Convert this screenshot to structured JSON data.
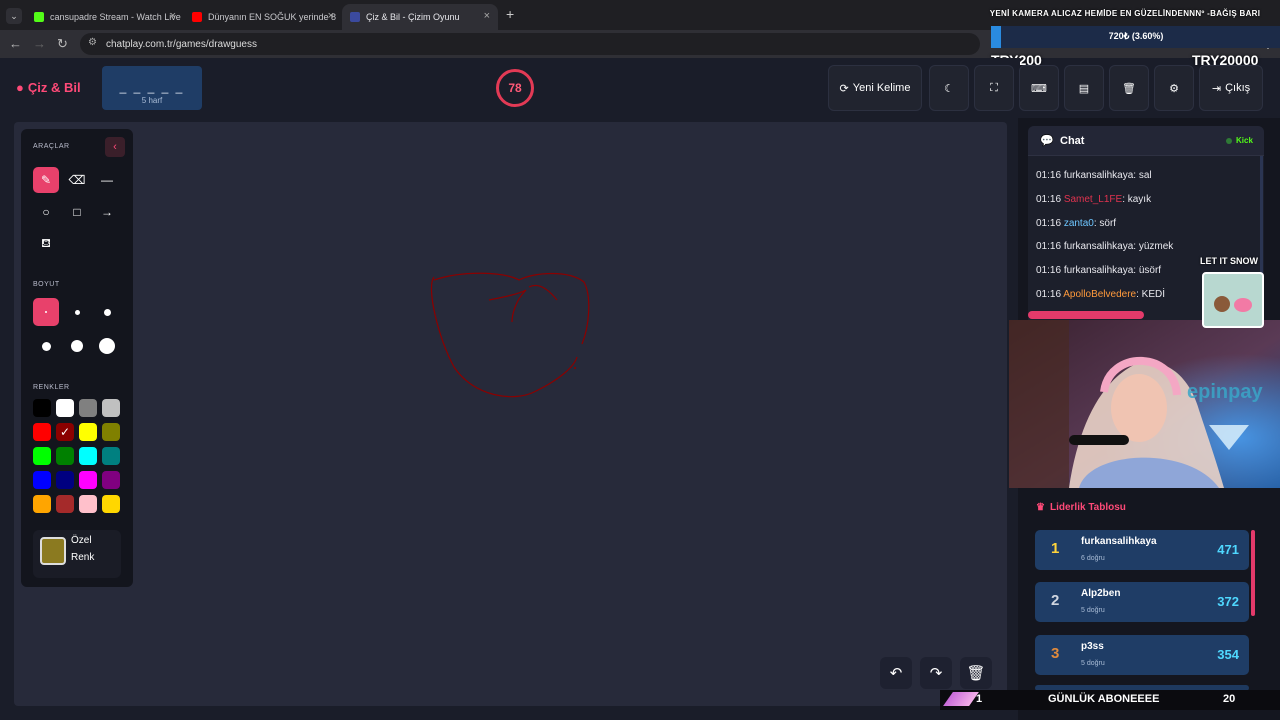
{
  "browser": {
    "tabs": [
      {
        "title": "cansupadre Stream - Watch Live"
      },
      {
        "title": "Dünyanın EN SOĞUK yerinde 8"
      },
      {
        "title": "Çiz & Bil - Çizim Oyunu"
      }
    ],
    "new_tab": "+",
    "url": "chatplay.com.tr/games/drawguess"
  },
  "overlay": {
    "title": "YENİ KAMERA ALICAZ HEMİDE EN GÜZELİNDENNNº -BAĞIŞ BARI",
    "goal_text": "720₺ (3.60%)",
    "goal_fraction": 0.036,
    "goal_left": "TRY200",
    "goal_right": "TRY20000",
    "ticker_left": "1",
    "ticker_text": "GÜNLÜK ABONEEEE",
    "ticker_right": "20",
    "sticker_text": "LET IT SNOW",
    "sponsor": "epinpay"
  },
  "app": {
    "logo": "Çiz & Bil",
    "word_blanks": "_ _ _ _ _",
    "word_count": "5 harf",
    "timer": "78",
    "buttons": {
      "new_word": "Yeni Kelime",
      "exit": "Çıkış"
    }
  },
  "tools": {
    "tools_title": "ARAÇLAR",
    "size_title": "BOYUT",
    "colors_title": "RENKLER",
    "custom_label_1": "Özel",
    "custom_label_2": "Renk",
    "custom_color": "#8b7a20",
    "palette": [
      "#000000",
      "#ffffff",
      "#808080",
      "#c0c0c0",
      "#ff0000",
      "#8b0000",
      "#ffff00",
      "#808000",
      "#00ff00",
      "#008000",
      "#00ffff",
      "#008080",
      "#0000ff",
      "#000080",
      "#ff00ff",
      "#800080",
      "#ffa500",
      "#a52a2a",
      "#ffc0cb",
      "#ffd700"
    ],
    "selected_color": "#8b0000"
  },
  "chat": {
    "title": "Chat",
    "platform": "Kick",
    "messages": [
      {
        "time": "01:16",
        "user": "furkansalihkaya",
        "user_color": "#e8e8ee",
        "text": ": sal"
      },
      {
        "time": "01:16",
        "user": "Samet_L1FE",
        "user_color": "#e0334f",
        "text": ": kayık"
      },
      {
        "time": "01:16",
        "user": "zanta0",
        "user_color": "#6ec6ff",
        "text": ": sörf"
      },
      {
        "time": "01:16",
        "user": "furkansalihkaya",
        "user_color": "#e8e8ee",
        "text": ": yüzmek"
      },
      {
        "time": "01:16",
        "user": "furkansalihkaya",
        "user_color": "#e8e8ee",
        "text": ": üsörf"
      },
      {
        "time": "01:16",
        "user": "ApolloBelvedere",
        "user_color": "#ff9a3c",
        "text": ": KEDİ"
      }
    ]
  },
  "leaderboard": {
    "title": "Liderlik Tablosu",
    "rows": [
      {
        "rank": "1",
        "name": "furkansalihkaya",
        "sub": "6 doğru",
        "score": "471",
        "rank_color": "#ffd43b"
      },
      {
        "rank": "2",
        "name": "Alp2ben",
        "sub": "5 doğru",
        "score": "372",
        "rank_color": "#d0d6e0"
      },
      {
        "rank": "3",
        "name": "p3ss",
        "sub": "5 doğru",
        "score": "354",
        "rank_color": "#e08a3c"
      }
    ]
  },
  "colors": {
    "accent": "#e8416b",
    "canvas": "#272a3a",
    "stroke": "#8b0000"
  }
}
